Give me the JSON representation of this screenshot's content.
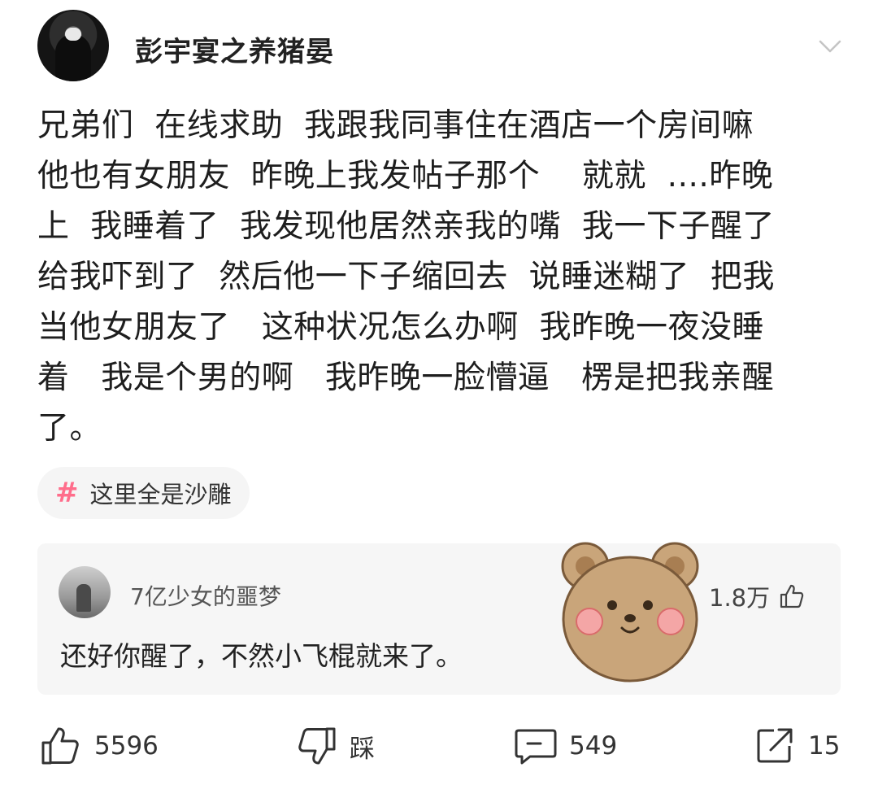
{
  "post": {
    "username": "彭宇宴之养猪晏",
    "body": "兄弟们  在线求助  我跟我同事住在酒店一个房间嘛\n他也有女朋友  昨晚上我发帖子那个    就就  ....昨晚\n上  我睡着了  我发现他居然亲我的嘴  我一下子醒了\n给我吓到了  然后他一下子缩回去  说睡迷糊了  把我\n当他女朋友了   这种状况怎么办啊  我昨晚一夜没睡\n着   我是个男的啊   我昨晚一脸懵逼   楞是把我亲醒\n了。",
    "topic_tag": "这里全是沙雕"
  },
  "top_comment": {
    "username": "7亿少女的噩梦",
    "text": "还好你醒了，不然小飞棍就来了。",
    "likes": "1.8万"
  },
  "actions": {
    "likes": "5596",
    "dislike_label": "踩",
    "comments": "549",
    "shares": "15"
  },
  "colors": {
    "tag_hash": "#ff6d8b",
    "card_bg": "#f6f6f6",
    "bear": "#c9a57a"
  },
  "icons": [
    "chevron-down-icon",
    "hash-icon",
    "thumbs-up-icon",
    "thumbs-down-icon",
    "comment-icon",
    "share-icon",
    "bear-sticker"
  ]
}
